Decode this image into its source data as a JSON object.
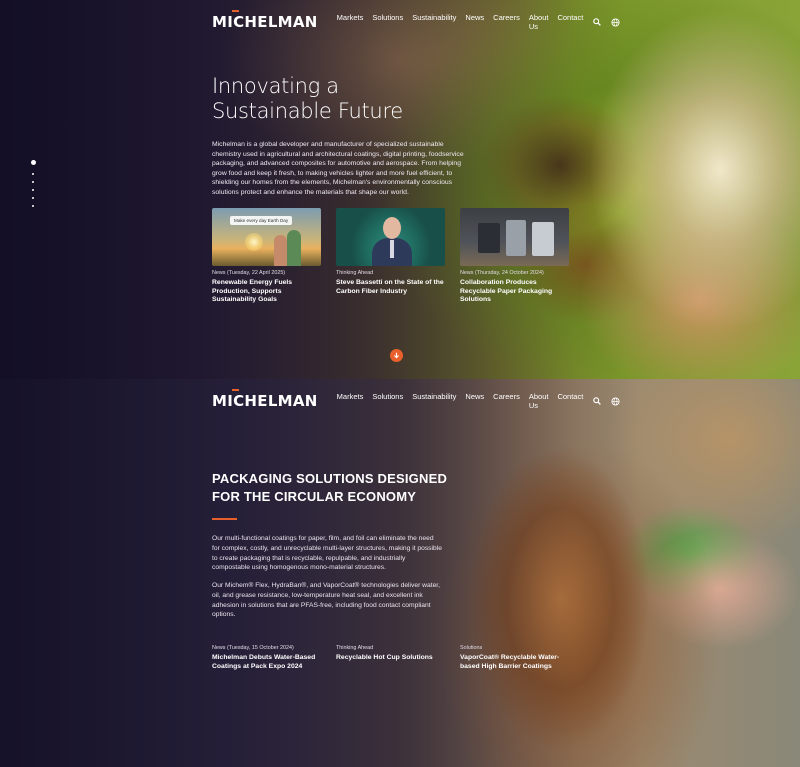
{
  "brand": {
    "logo": "MICHELMAN",
    "accent_color": "#e8612c"
  },
  "nav": {
    "items": [
      "Markets",
      "Solutions",
      "Sustainability",
      "News",
      "Careers",
      "About Us",
      "Contact"
    ]
  },
  "icons": {
    "search": "search-icon",
    "language": "globe-icon",
    "scroll": "arrow-down-icon"
  },
  "hero": {
    "title_line1": "Innovating a",
    "title_line2": "Sustainable Future",
    "body": "Michelman is a global developer and manufacturer of specialized sustainable chemistry used in agricultural and architectural coatings, digital printing, foodservice packaging, and advanced composites for automotive and aerospace. From helping grow food and keep it fresh, to making vehicles lighter and more fuel efficient, to shielding our homes from the elements, Michelman's environmentally conscious solutions protect and enhance the materials that shape our world.",
    "slide_count": 6,
    "active_slide": 1,
    "cards": [
      {
        "image_tag": "Make every day Earth Day",
        "meta": "News (Tuesday, 22 April 2025)",
        "title": "Renewable Energy Fuels Production, Supports Sustainability Goals"
      },
      {
        "meta": "Thinking Ahead",
        "title": "Steve Bassetti on the State of the Carbon Fiber Industry"
      },
      {
        "meta": "News (Thursday, 24 October 2024)",
        "title": "Collaboration Produces Recyclable Paper Packaging Solutions"
      }
    ]
  },
  "packaging": {
    "title": "PACKAGING SOLUTIONS DESIGNED FOR THE CIRCULAR ECONOMY",
    "paragraph1": "Our multi-functional coatings for paper, film, and foil can eliminate the need for complex, costly, and unrecyclable multi-layer structures, making it possible to create packaging that is recyclable, repulpable, and industrially compostable using homogenous mono-material structures.",
    "paragraph2": "Our Michem® Flex, HydraBan®, and VaporCoat® technologies deliver water, oil, and grease resistance, low-temperature heat seal, and excellent ink adhesion in solutions that are PFAS-free, including food contact compliant options.",
    "cards": [
      {
        "meta": "News (Tuesday, 15 October 2024)",
        "title": "Michelman Debuts Water-Based Coatings at Pack Expo 2024"
      },
      {
        "meta": "Thinking Ahead",
        "title": "Recyclable Hot Cup Solutions"
      },
      {
        "meta": "Solutions",
        "title": "VaporCoat® Recyclable Water-based High Barrier Coatings"
      }
    ]
  }
}
